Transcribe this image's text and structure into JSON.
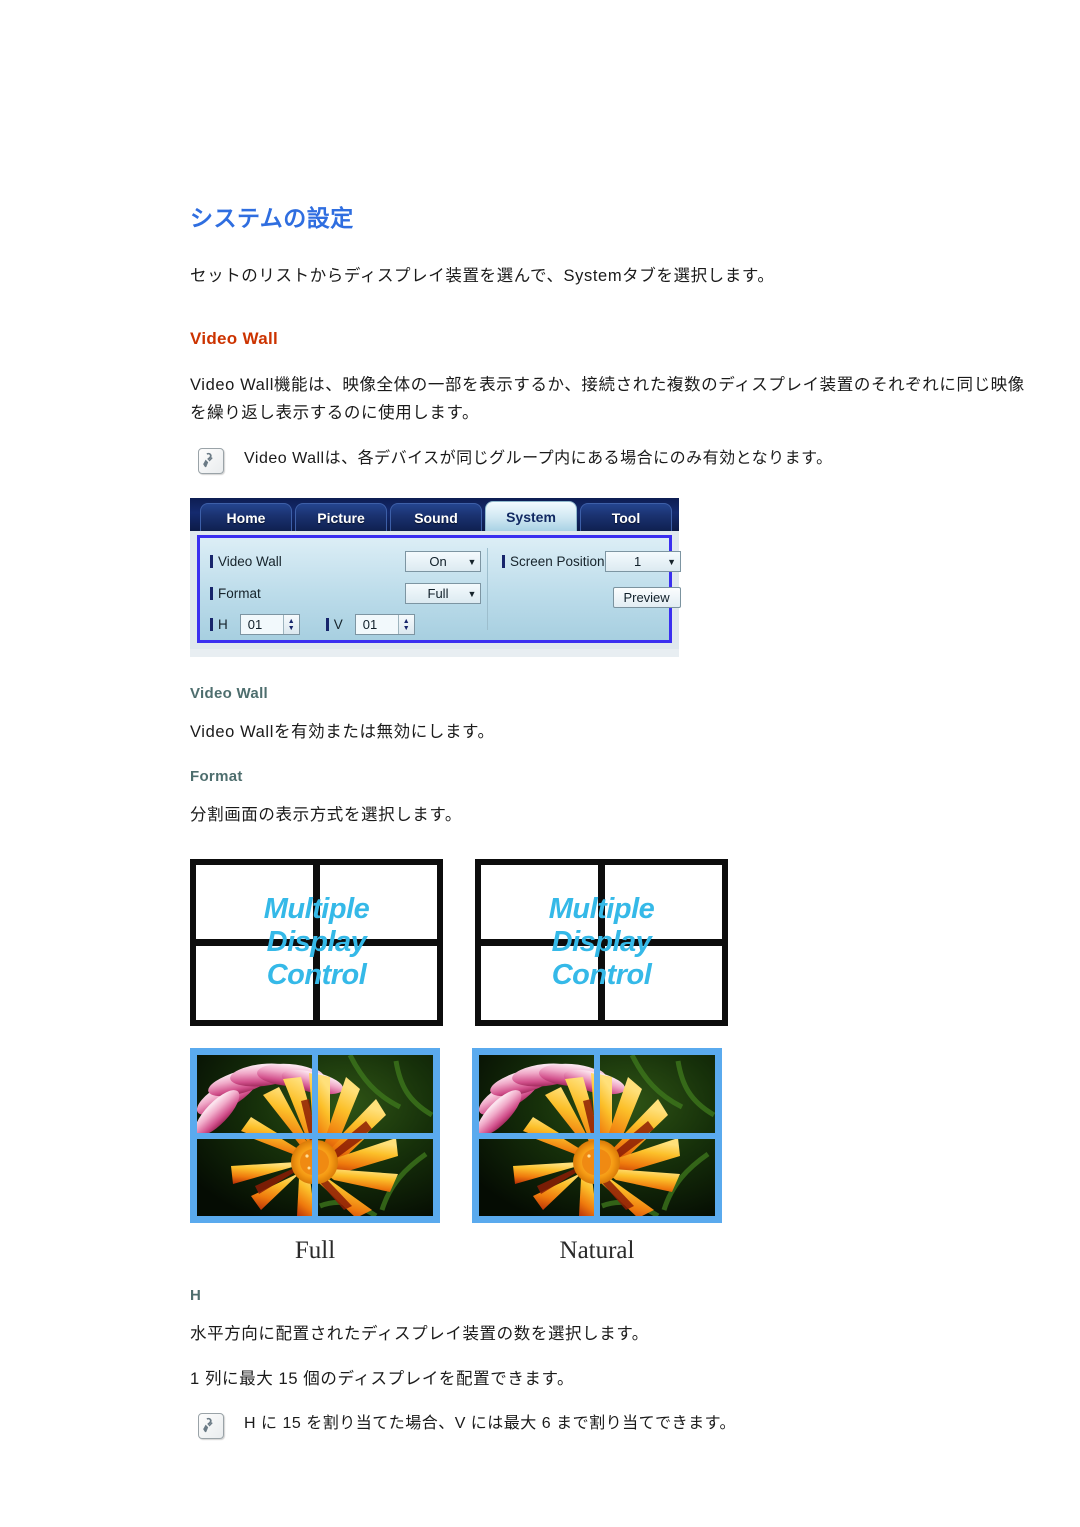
{
  "page": {
    "title": "システムの設定",
    "intro": "セットのリストからディスプレイ装置を選んで、Systemタブを選択します。"
  },
  "video_wall_section": {
    "heading": "Video Wall",
    "description": "Video Wall機能は、映像全体の一部を表示するか、接続された複数のディスプレイ装置のそれぞれに同じ映像を繰り返し表示するのに使用します。",
    "note": "Video Wallは、各デバイスが同じグループ内にある場合にのみ有効となります。",
    "note_icon": "note-pen-icon"
  },
  "device_panel": {
    "tabs": [
      {
        "label": "Home",
        "active": false
      },
      {
        "label": "Picture",
        "active": false
      },
      {
        "label": "Sound",
        "active": false
      },
      {
        "label": "System",
        "active": true
      },
      {
        "label": "Tool",
        "active": false
      }
    ],
    "left_column": {
      "video_wall": {
        "label": "Video Wall",
        "value": "On"
      },
      "format": {
        "label": "Format",
        "value": "Full"
      },
      "h": {
        "label": "H",
        "value": "01"
      },
      "v": {
        "label": "V",
        "value": "01"
      }
    },
    "right_column": {
      "screen_position": {
        "label": "Screen Position",
        "value": "1"
      },
      "preview_button": "Preview"
    },
    "colors": {
      "panel_border": "#3a2ff0",
      "tabbar_bg": "#0d1d52",
      "active_tab_text": "#122a63"
    }
  },
  "video_wall_detail": {
    "heading": "Video Wall",
    "text": "Video Wallを有効または無効にします。"
  },
  "format_detail": {
    "heading": "Format",
    "text": "分割画面の表示方式を選択します。"
  },
  "wall_diagrams": {
    "screen_text_lines": [
      "Multiple",
      "Display",
      "Control"
    ],
    "text_color": "#35b9e8",
    "bezel_color": "#0d0d0d",
    "photo_bezel_color": "#5aaaee",
    "captions": [
      "Full",
      "Natural"
    ]
  },
  "h_section": {
    "heading": "H",
    "line1": "水平方向に配置されたディスプレイ装置の数を選択します。",
    "line2": "1 列に最大 15 個のディスプレイを配置できます。",
    "note": "H に 15 を割り当てた場合、V には最大 6 まで割り当てできます。",
    "note_icon": "note-pen-icon"
  }
}
